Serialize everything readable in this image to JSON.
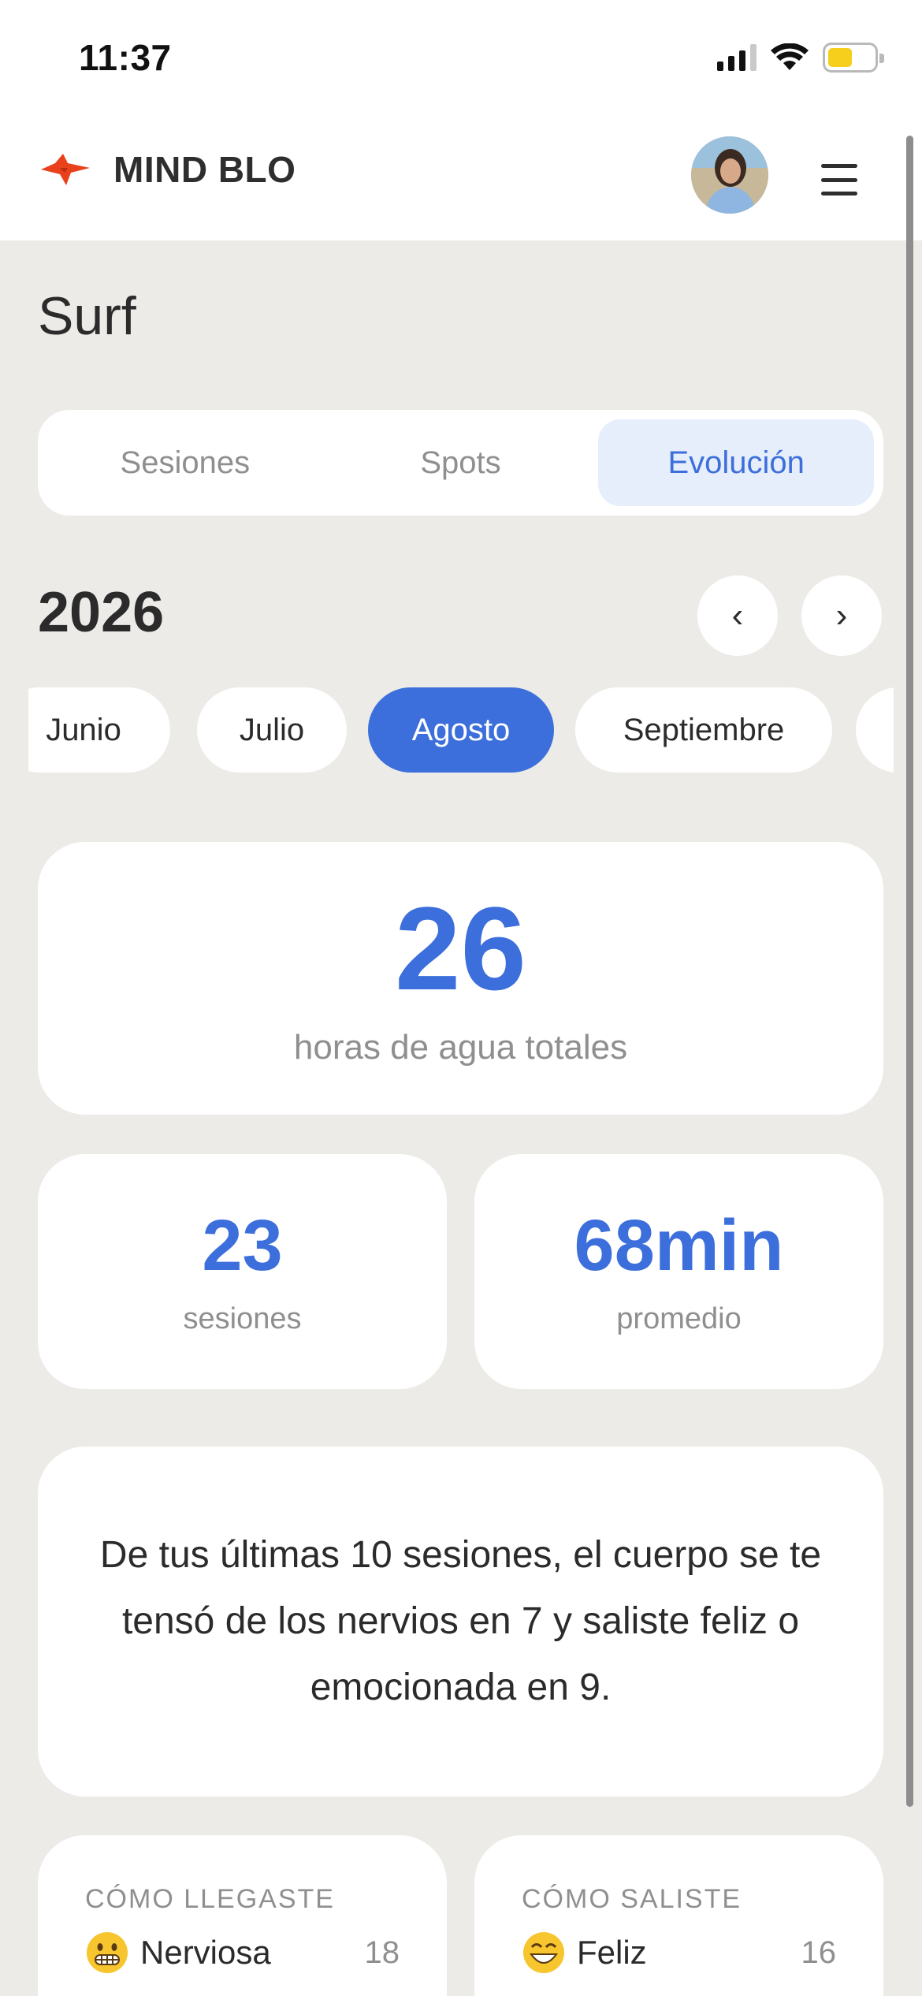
{
  "status_bar": {
    "time": "11:37"
  },
  "header": {
    "brand": "MIND BLO"
  },
  "page": {
    "title": "Surf"
  },
  "tabs": [
    {
      "label": "Sesiones"
    },
    {
      "label": "Spots"
    },
    {
      "label": "Evolución"
    }
  ],
  "active_tab": "Evolución",
  "year": {
    "value": "2026",
    "prev": "‹",
    "next": "›"
  },
  "months": [
    {
      "label": "Junio"
    },
    {
      "label": "Julio"
    },
    {
      "label": "Agosto"
    },
    {
      "label": "Septiembre"
    }
  ],
  "selected_month": "Agosto",
  "stats": {
    "total_hours": "26",
    "total_hours_label": "horas de agua totales",
    "sessions": "23",
    "sessions_label": "sesiones",
    "average": "68min",
    "average_label": "promedio"
  },
  "insight": "De tus últimas 10 sesiones, el cuerpo se te tensó de los nervios en 7 y saliste feliz o emocionada en 9.",
  "mood_in": {
    "title": "CÓMO LLEGASTE",
    "label": "Nerviosa",
    "count": "18",
    "icon": "grimacing-face-icon"
  },
  "mood_out": {
    "title": "CÓMO SALISTE",
    "label": "Feliz",
    "count": "16",
    "icon": "grinning-face-icon"
  },
  "colors": {
    "accent": "#3c6fdc",
    "background": "#edebe7",
    "brand": "#e8411c"
  }
}
